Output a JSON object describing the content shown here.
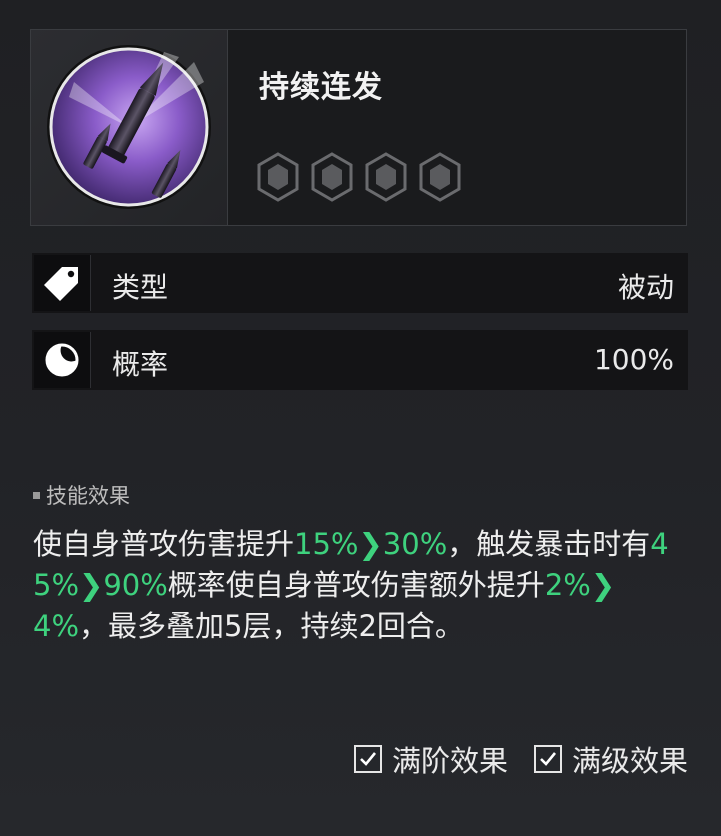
{
  "skill": {
    "name": "持续连发",
    "hex_slots": 4
  },
  "attributes": [
    {
      "icon": "tag-icon",
      "label": "类型",
      "value": "被动"
    },
    {
      "icon": "moon-icon",
      "label": "概率",
      "value": "100%"
    }
  ],
  "effect": {
    "title": "技能效果",
    "seg1": "使自身普攻伤害提升",
    "v1a": "15%",
    "v1b": "30%",
    "seg2": "，触发暴击时有",
    "v2a": "45%",
    "v2b": "90%",
    "seg3": "概率使自身普攻伤害额外提升",
    "v3a": "2%",
    "v3b": "4%",
    "seg4": "，最多叠加5层，持续2回合。"
  },
  "toggles": [
    {
      "label": "满阶效果",
      "checked": true
    },
    {
      "label": "满级效果",
      "checked": true
    }
  ],
  "colors": {
    "accent_green": "#3ed27e",
    "icon_purple": "#8a5cc9"
  }
}
